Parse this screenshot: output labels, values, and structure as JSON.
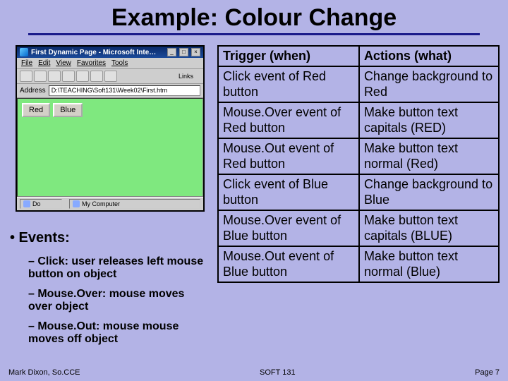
{
  "title": "Example: Colour Change",
  "browser": {
    "titlebar": "First Dynamic Page - Microsoft Inte…",
    "menu": {
      "file": "File",
      "edit": "Edit",
      "view": "View",
      "favorites": "Favorites",
      "tools": "Tools"
    },
    "links_label": "Links",
    "address_label": "Address",
    "address_value": "D:\\TEACHING\\Soft131\\Week02\\First.htm",
    "btn_red": "Red",
    "btn_blue": "Blue",
    "status_left": "Do",
    "status_right": "My Computer",
    "min": "_",
    "max": "□",
    "close": "×"
  },
  "events": {
    "heading": "• Events:",
    "items": [
      "– Click: user releases left mouse button on object",
      "– Mouse.Over: mouse moves over object",
      "– Mouse.Out: mouse mouse moves off object"
    ]
  },
  "table": {
    "header": {
      "trigger": "Trigger (when)",
      "actions": "Actions (what)"
    },
    "rows": [
      {
        "t": "Click event of Red button",
        "a": "Change background to Red"
      },
      {
        "t": "Mouse.Over event of Red button",
        "a": "Make button text capitals (RED)"
      },
      {
        "t": "Mouse.Out event of Red button",
        "a": "Make button text normal (Red)"
      },
      {
        "t": "Click event of Blue button",
        "a": "Change background to Blue"
      },
      {
        "t": "Mouse.Over event of Blue button",
        "a": "Make button text capitals (BLUE)"
      },
      {
        "t": "Mouse.Out event of Blue button",
        "a": "Make button text normal (Blue)"
      }
    ]
  },
  "footer": {
    "left": "Mark Dixon, So.CCE",
    "center": "SOFT 131",
    "right": "Page 7"
  }
}
